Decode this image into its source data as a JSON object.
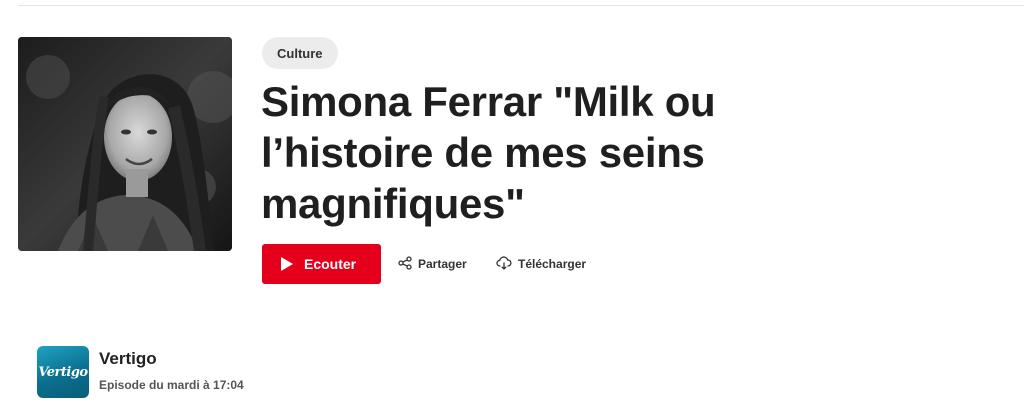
{
  "episode": {
    "category": "Culture",
    "title": "Simona Ferrar \"Milk ou l’histoire de mes seins magnifiques\"",
    "image_alt": "Portrait de Simona Ferrar"
  },
  "actions": {
    "listen_label": "Ecouter",
    "share_label": "Partager",
    "download_label": "Télécharger"
  },
  "show": {
    "name": "Vertigo",
    "logo_text": "Vertigo",
    "meta": "Episode du mardi à 17:04"
  },
  "colors": {
    "accent": "#e4001b",
    "chip_bg": "#ececec",
    "logo": "#1fa3c4"
  }
}
